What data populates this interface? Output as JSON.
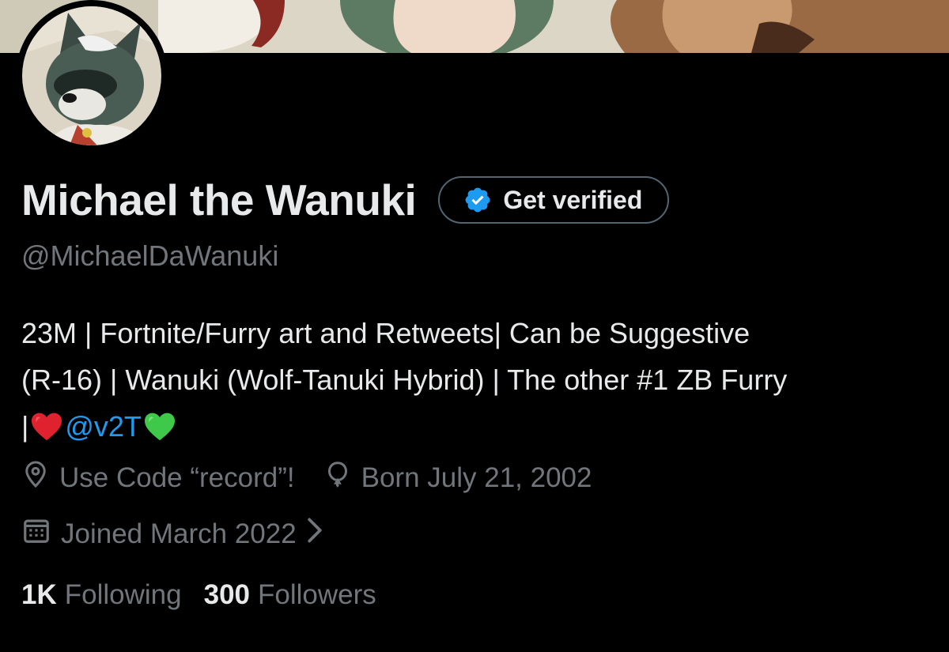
{
  "profile": {
    "display_name": "Michael the Wanuki",
    "verify_button_label": "Get verified",
    "handle": "@MichaelDaWanuki",
    "bio": {
      "line1": "23M | Fortnite/Furry art and Retweets| Can be Suggestive",
      "line2": "(R-16) | Wanuki (Wolf-Tanuki Hybrid) | The other #1 ZB Furry",
      "line3_prefix": "|",
      "line3_mention": "@v2T"
    },
    "location": "Use Code “record”!",
    "birthday": "Born July 21, 2002",
    "joined": "Joined March 2022",
    "following_count": "1K",
    "following_label": "Following",
    "followers_count": "300",
    "followers_label": "Followers"
  },
  "icons": {
    "verified": "verified-badge-icon",
    "location": "location-pin-icon",
    "birthday": "balloon-icon",
    "joined": "calendar-icon",
    "chevron": "chevron-right-icon",
    "heart_red": "red-heart-emoji",
    "heart_green": "green-heart-emoji"
  },
  "colors": {
    "background": "#000000",
    "primary_text": "#e7e9ea",
    "secondary_text": "#71767b",
    "accent": "#1d9bf0",
    "button_border": "#536471"
  }
}
